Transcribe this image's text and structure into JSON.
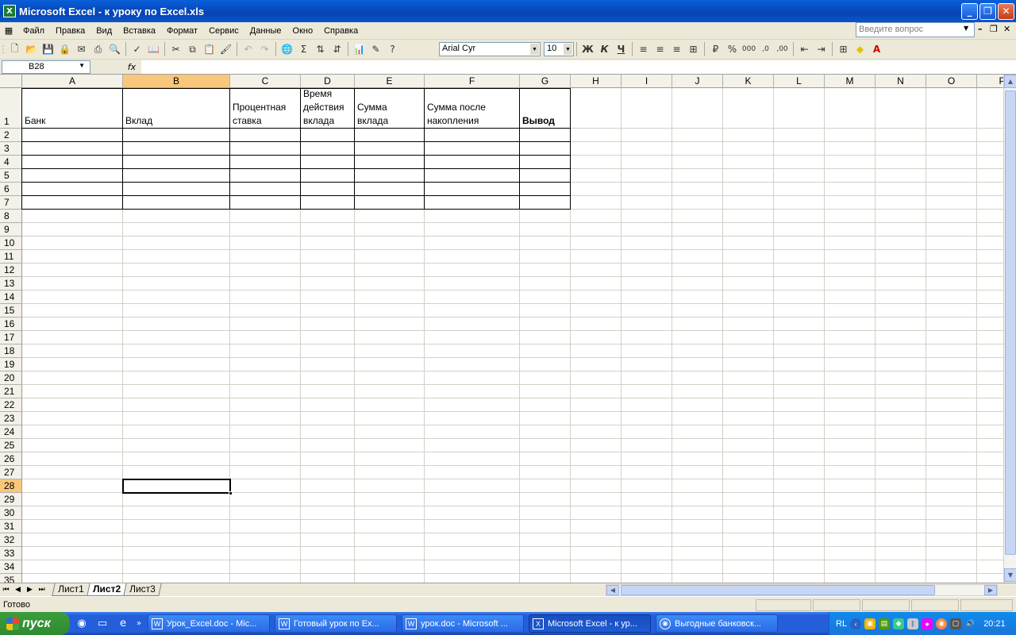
{
  "window": {
    "title": "Microsoft Excel - к уроку по Excel.xls",
    "app_icon": "excel-icon"
  },
  "menu": {
    "items": [
      "Файл",
      "Правка",
      "Вид",
      "Вставка",
      "Формат",
      "Сервис",
      "Данные",
      "Окно",
      "Справка"
    ],
    "help_placeholder": "Введите вопрос"
  },
  "formatting": {
    "font_name": "Arial Cyr",
    "font_size": "10",
    "bold": "Ж",
    "italic": "К",
    "underline": "Ч",
    "percent": "%"
  },
  "formula_bar": {
    "name_box": "B28",
    "fx_label": "fx",
    "formula": ""
  },
  "columns": [
    "A",
    "B",
    "C",
    "D",
    "E",
    "F",
    "G",
    "H",
    "I",
    "J",
    "K",
    "L",
    "M",
    "N",
    "O",
    "P"
  ],
  "rows": [
    "1",
    "2",
    "3",
    "4",
    "5",
    "6",
    "7",
    "8",
    "9",
    "10",
    "11",
    "12",
    "13",
    "14",
    "15",
    "16",
    "17",
    "18",
    "19",
    "20",
    "21",
    "22",
    "23",
    "24",
    "25",
    "26",
    "27",
    "28",
    "29",
    "30",
    "31",
    "32",
    "33",
    "34",
    "35"
  ],
  "selected": {
    "column": "B",
    "row": "28"
  },
  "table_headers": {
    "A": "Банк",
    "B": "Вклад",
    "C_line1": "Процентная",
    "C_line2": "ставка",
    "D_line1": "Время",
    "D_line2": "действия",
    "D_line3": "вклада",
    "E_line1": "Сумма",
    "E_line2": "вклада",
    "F_line1": "Сумма после",
    "F_line2": "накопления",
    "G": "Вывод"
  },
  "sheets": {
    "tabs": [
      "Лист1",
      "Лист2",
      "Лист3"
    ],
    "active": "Лист2"
  },
  "status": {
    "text": "Готово"
  },
  "taskbar": {
    "start_label": "пуск",
    "tasks": [
      "Урок_Excel.doc - Mic...",
      "Готовый урок по Ex...",
      "урок.doc - Microsoft ...",
      "Microsoft Excel - к ур...",
      "Выгодные банковск..."
    ],
    "active_task_index": 3,
    "language": "RL",
    "clock": "20:21"
  },
  "colors": {
    "title_blue": "#0544b5",
    "selected_header": "#f9c77b",
    "toolbar": "#ece9d8"
  }
}
